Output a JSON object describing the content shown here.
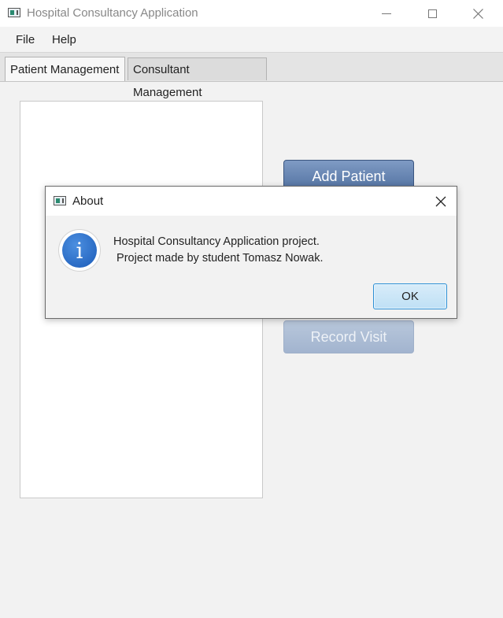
{
  "window": {
    "title": "Hospital Consultancy Application",
    "controls": {
      "minimize_icon": "minimize-icon",
      "maximize_icon": "maximize-icon",
      "close_icon": "close-icon"
    }
  },
  "menubar": {
    "items": [
      {
        "label": "File"
      },
      {
        "label": "Help"
      }
    ]
  },
  "tabs": [
    {
      "label": "Patient Management",
      "selected": true
    },
    {
      "label": "Consultant Management",
      "selected": false
    }
  ],
  "main": {
    "buttons": {
      "add_patient": "Add Patient",
      "record_visit": "Record Visit"
    }
  },
  "dialog": {
    "title": "About",
    "icon": "info-icon",
    "message": "Hospital Consultancy Application project.\n Project made by student Tomasz Nowak.",
    "ok_label": "OK"
  },
  "colors": {
    "primary_button": "#4f6f9f",
    "disabled_button": "#a2b4cf",
    "ok_border": "#2c8fd4",
    "info_icon": "#1b5bb8"
  }
}
